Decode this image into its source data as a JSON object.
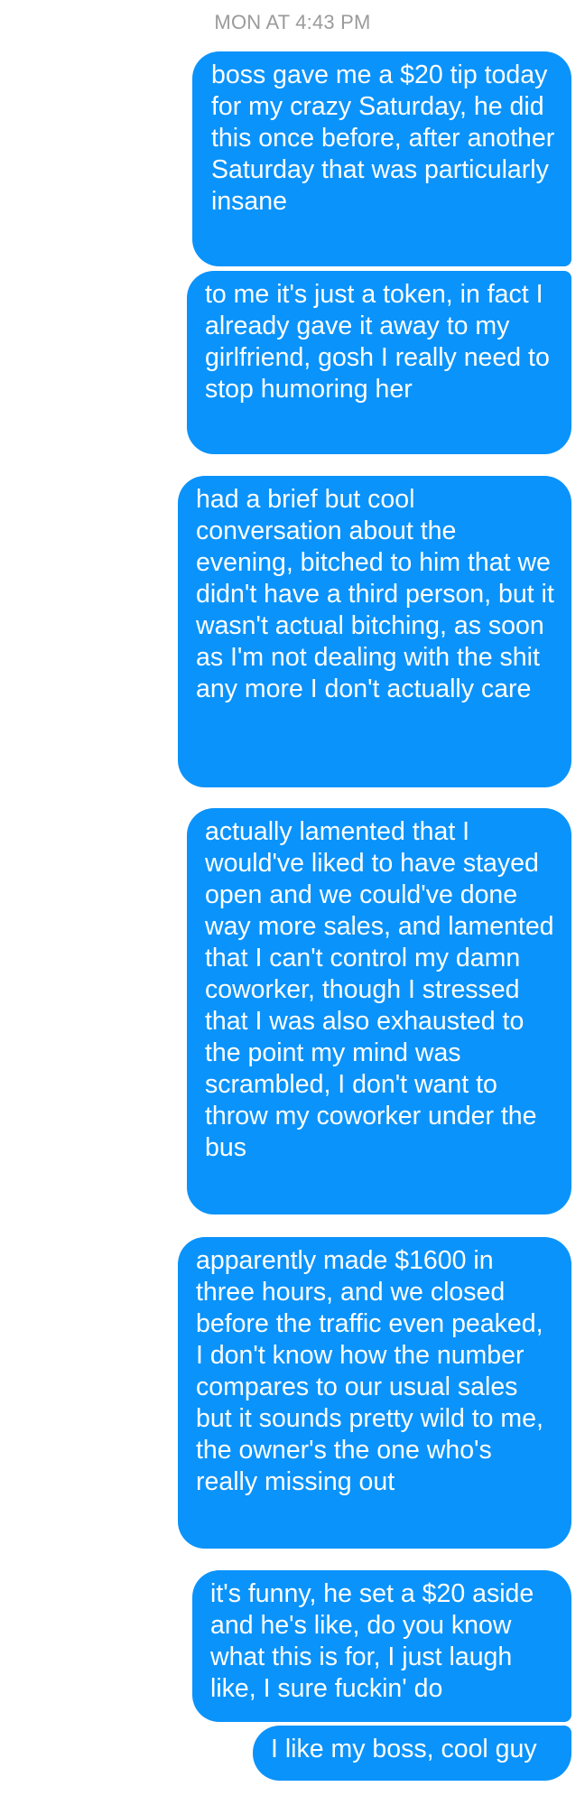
{
  "conversation": {
    "timestamp": "MON AT 4:43 PM",
    "accent_color": "#0a93fb",
    "messages": [
      {
        "sender": "me",
        "text": "boss gave me a $20 tip today for my crazy Saturday, he did this once before, after another Saturday that was particularly insane"
      },
      {
        "sender": "me",
        "text": "to me it's just a token, in fact I already gave it away to my girlfriend, gosh I really need to stop humoring her"
      },
      {
        "sender": "me",
        "text": "had a brief but cool conversation about the evening, bitched to him that we didn't have a third person, but it wasn't actual bitching, as soon as I'm not dealing with the shit any more I don't actually care"
      },
      {
        "sender": "me",
        "text": "actually lamented that I would've liked to have stayed open and we could've done way more sales, and lamented that I can't control my damn coworker, though I stressed that I was also exhausted to the point my mind was scrambled, I don't want to throw my coworker under the bus"
      },
      {
        "sender": "me",
        "text": "apparently made $1600 in three hours, and we closed before the traffic even peaked, I don't know how the number compares to our usual sales but it sounds pretty wild to me, the owner's the one who's really missing out"
      },
      {
        "sender": "me",
        "text": "it's funny, he set a $20 aside and he's like, do you know what this is for, I just laugh like, I sure fuckin' do"
      },
      {
        "sender": "me",
        "text": "I like my boss, cool guy"
      }
    ]
  }
}
